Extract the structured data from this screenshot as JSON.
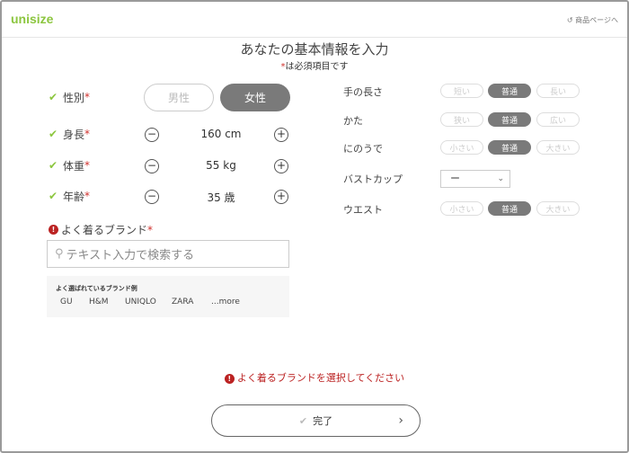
{
  "header": {
    "logo": "unisize",
    "back_link": "↺ 商品ページへ"
  },
  "title": "あなたの基本情報を入力",
  "subtitle_mark": "*",
  "subtitle": "は必須項目です",
  "left": {
    "gender": {
      "label": "性別",
      "options": [
        "男性",
        "女性"
      ],
      "selected": "女性"
    },
    "height": {
      "label": "身長",
      "value": "160 cm"
    },
    "weight": {
      "label": "体重",
      "value": "55 kg"
    },
    "age": {
      "label": "年齢",
      "value": "35 歳"
    },
    "required_mark": "*",
    "check": "✔",
    "minus": "−",
    "plus": "+"
  },
  "right": {
    "arm_length": {
      "label": "手の長さ",
      "options": [
        "短い",
        "普通",
        "長い"
      ],
      "selected": "普通"
    },
    "shoulder": {
      "label": "かた",
      "options": [
        "狭い",
        "普通",
        "広い"
      ],
      "selected": "普通"
    },
    "upper_arm": {
      "label": "にのうで",
      "options": [
        "小さい",
        "普通",
        "大きい"
      ],
      "selected": "普通"
    },
    "bust_cup": {
      "label": "バストカップ",
      "value": "ー"
    },
    "waist": {
      "label": "ウエスト",
      "options": [
        "小さい",
        "普通",
        "大きい"
      ],
      "selected": "普通"
    }
  },
  "brand": {
    "label": "よく着るブランド",
    "placeholder": "テキスト入力で検索する",
    "suggest_title": "よく選ばれているブランド例",
    "suggestions": [
      "GU",
      "H&M",
      "UNIQLO",
      "ZARA",
      "...more"
    ]
  },
  "error_message": "よく着るブランドを選択してください",
  "submit": {
    "label": "完了",
    "arrow": "›"
  },
  "colors": {
    "accent": "#8cc63f",
    "error": "#bb2222",
    "selected": "#7a7a7a"
  }
}
